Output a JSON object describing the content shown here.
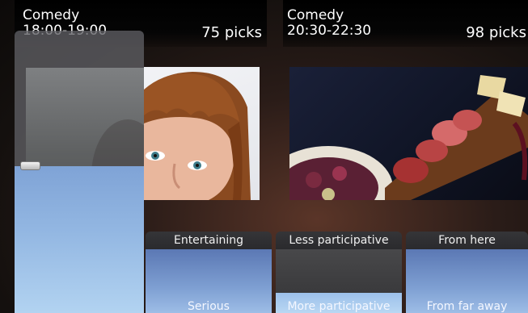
{
  "programs": [
    {
      "genre": "Comedy",
      "time": "18:00-19:00",
      "picks": "75 picks"
    },
    {
      "genre": "Comedy",
      "time": "20:30-22:30",
      "picks": "98 picks"
    }
  ],
  "preference_slider": {
    "level": 0.52
  },
  "preference_cards": [
    {
      "top_label": "Entertaining",
      "bottom_label": "Serious"
    },
    {
      "top_label": "Less participative",
      "bottom_label": "More participative"
    },
    {
      "top_label": "From here",
      "bottom_label": "From far away"
    }
  ],
  "colors": {
    "slider_fill": "#93b7e2",
    "card_fill": "#7e9fd2",
    "header_bg": "#000000"
  }
}
